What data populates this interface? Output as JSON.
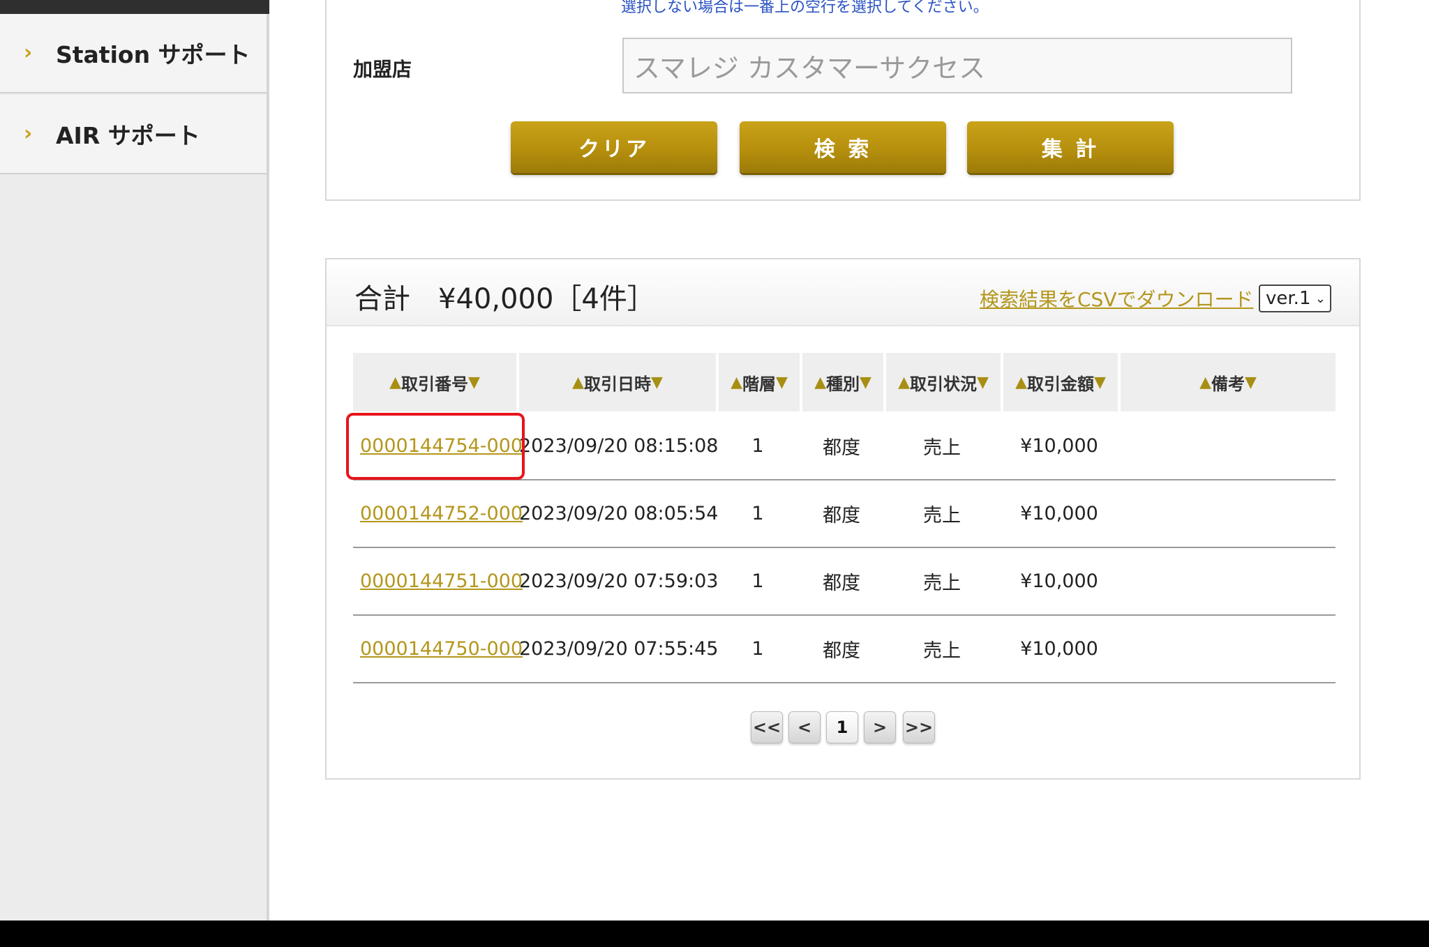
{
  "sidebar": {
    "items": [
      {
        "label": "Station サポート"
      },
      {
        "label": "AIR サポート"
      }
    ]
  },
  "search": {
    "hint": "選択しない場合は一番上の空行を選択してください。",
    "store_label": "加盟店",
    "store_value": "スマレジ カスタマーサクセス",
    "clear_label": "クリア",
    "search_label": "検 索",
    "aggregate_label": "集 計"
  },
  "results": {
    "total": "合計　¥40,000［4件］",
    "csv_link": "検索結果をCSVでダウンロード",
    "version": "ver.1",
    "columns": [
      "取引番号",
      "取引日時",
      "階層",
      "種別",
      "取引状況",
      "取引金額",
      "備考"
    ],
    "rows": [
      {
        "id": "0000144754-000",
        "datetime": "2023/09/20 08:15:08",
        "level": "1",
        "type": "都度",
        "status": "売上",
        "amount": "¥10,000",
        "note": ""
      },
      {
        "id": "0000144752-000",
        "datetime": "2023/09/20 08:05:54",
        "level": "1",
        "type": "都度",
        "status": "売上",
        "amount": "¥10,000",
        "note": ""
      },
      {
        "id": "0000144751-000",
        "datetime": "2023/09/20 07:59:03",
        "level": "1",
        "type": "都度",
        "status": "売上",
        "amount": "¥10,000",
        "note": ""
      },
      {
        "id": "0000144750-000",
        "datetime": "2023/09/20 07:55:45",
        "level": "1",
        "type": "都度",
        "status": "売上",
        "amount": "¥10,000",
        "note": ""
      }
    ]
  },
  "pagination": {
    "first": "<<",
    "prev": "<",
    "current": "1",
    "next": ">",
    "last": ">>"
  },
  "colors": {
    "accent_gold": "#b4961c",
    "highlight_red": "#e8141b",
    "hint_blue": "#2a52c4"
  }
}
